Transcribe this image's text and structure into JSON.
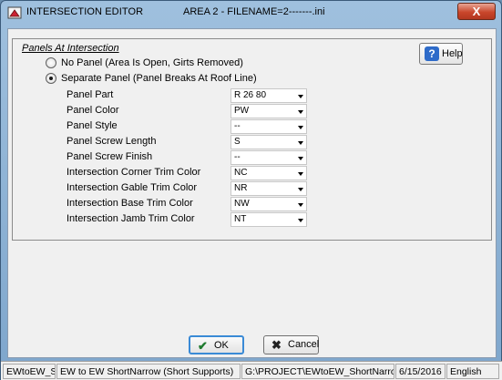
{
  "window": {
    "title": "INTERSECTION EDITOR",
    "subtitle": "AREA 2 - FILENAME=2-------.ini",
    "close_label": "X"
  },
  "group": {
    "title": "Panels At Intersection",
    "help_label": "Help",
    "options": [
      {
        "label": "No Panel (Area Is Open, Girts Removed)",
        "selected": false
      },
      {
        "label": "Separate Panel (Panel Breaks At Roof Line)",
        "selected": true
      }
    ],
    "fields": [
      {
        "label": "Panel Part",
        "value": "R 26 80"
      },
      {
        "label": "Panel Color",
        "value": "PW"
      },
      {
        "label": "Panel Style",
        "value": "--"
      },
      {
        "label": "Panel Screw Length",
        "value": "S"
      },
      {
        "label": "Panel Screw Finish",
        "value": "--"
      },
      {
        "label": "Intersection Corner Trim Color",
        "value": "NC"
      },
      {
        "label": "Intersection Gable Trim Color",
        "value": "NR"
      },
      {
        "label": "Intersection Base Trim Color",
        "value": "NW"
      },
      {
        "label": "Intersection Jamb Trim Color",
        "value": "NT"
      }
    ]
  },
  "buttons": {
    "ok_label": "OK",
    "cancel_label": "Cancel"
  },
  "statusbar": [
    "EWtoEW_Sh",
    "EW to EW ShortNarrow (Short Supports)",
    "G:\\PROJECT\\EWtoEW_ShortNarrowS",
    "6/15/2016",
    "English"
  ]
}
